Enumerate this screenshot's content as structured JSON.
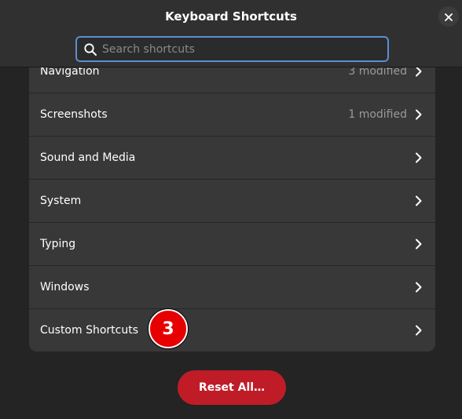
{
  "window": {
    "title": "Keyboard Shortcuts",
    "close_icon": "close-icon"
  },
  "search": {
    "placeholder": "Search shortcuts",
    "value": "",
    "icon": "search-icon"
  },
  "categories": [
    {
      "label": "Navigation",
      "status": "3 modified"
    },
    {
      "label": "Screenshots",
      "status": "1 modified"
    },
    {
      "label": "Sound and Media",
      "status": ""
    },
    {
      "label": "System",
      "status": ""
    },
    {
      "label": "Typing",
      "status": ""
    },
    {
      "label": "Windows",
      "status": ""
    },
    {
      "label": "Custom Shortcuts",
      "status": ""
    }
  ],
  "annotation_badge": "3",
  "reset_button": "Reset All…",
  "colors": {
    "accent": "#5b8fd0",
    "destructive": "#c01c28",
    "badge": "#e60000"
  }
}
